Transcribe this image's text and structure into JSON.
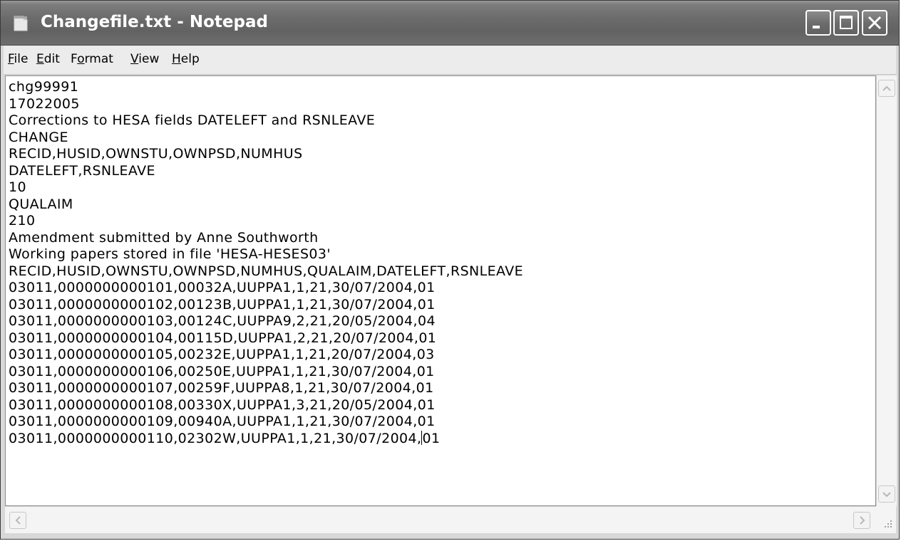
{
  "window": {
    "title": "Changefile.txt - Notepad",
    "app_icon": "notepad-icon"
  },
  "controls": {
    "minimize": "minimize-icon",
    "maximize": "maximize-icon",
    "close": "close-icon"
  },
  "menu": {
    "items": [
      {
        "label": "File",
        "accel": "F",
        "rest": "ile"
      },
      {
        "label": "Edit",
        "accel": "E",
        "rest": "dit"
      },
      {
        "label": "Format",
        "accel_pre": "F",
        "accel": "o",
        "rest": "rmat"
      },
      {
        "label": "View",
        "accel": "V",
        "rest": "iew"
      },
      {
        "label": "Help",
        "accel": "H",
        "rest": "elp"
      }
    ]
  },
  "document": {
    "lines": [
      "chg99991",
      "17022005",
      "Corrections to HESA fields DATELEFT and RSNLEAVE",
      "CHANGE",
      "RECID,HUSID,OWNSTU,OWNPSD,NUMHUS",
      "DATELEFT,RSNLEAVE",
      "10",
      "QUALAIM",
      "210",
      "Amendment submitted by Anne Southworth",
      "Working papers stored in file 'HESA-HESES03'",
      "RECID,HUSID,OWNSTU,OWNPSD,NUMHUS,QUALAIM,DATELEFT,RSNLEAVE",
      "03011,0000000000101,00032A,UUPPA1,1,21,30/07/2004,01",
      "03011,0000000000102,00123B,UUPPA1,1,21,30/07/2004,01",
      "03011,0000000000103,00124C,UUPPA9,2,21,20/05/2004,04",
      "03011,0000000000104,00115D,UUPPA1,2,21,20/07/2004,01",
      "03011,0000000000105,00232E,UUPPA1,1,21,20/07/2004,03",
      "03011,0000000000106,00250E,UUPPA1,1,21,30/07/2004,01",
      "03011,0000000000107,00259F,UUPPA8,1,21,30/07/2004,01",
      "03011,0000000000108,00330X,UUPPA1,3,21,20/05/2004,01",
      "03011,0000000000109,00940A,UUPPA1,1,21,30/07/2004,01"
    ],
    "last_line_before_caret": "03011,0000000000110,02302W,UUPPA1,1,21,30/07/2004,",
    "last_line_after_caret": "01"
  }
}
